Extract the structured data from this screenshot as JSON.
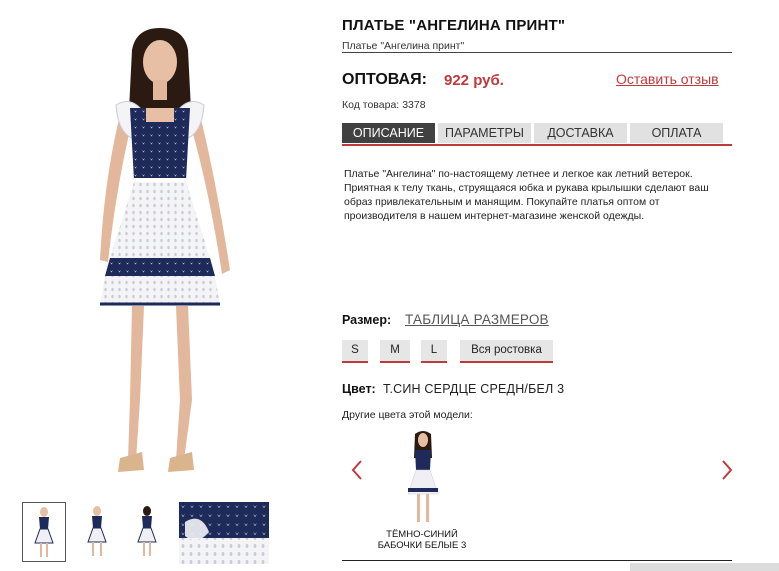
{
  "product": {
    "title": "ПЛАТЬЕ \"АНГЕЛИНА ПРИНТ\"",
    "subtitle": "Платье \"Ангелина принт\"",
    "price_label": "ОПТОВАЯ:",
    "price_value": "922 руб.",
    "review_link": "Оставить отзыв",
    "sku_label": "Код товара:",
    "sku_value": "3378"
  },
  "tabs": [
    {
      "label": "ОПИСАНИЕ",
      "active": true
    },
    {
      "label": "ПАРАМЕТРЫ",
      "active": false
    },
    {
      "label": "ДОСТАВКА",
      "active": false
    },
    {
      "label": "ОПЛАТА",
      "active": false
    }
  ],
  "description": "Платье \"Ангелина\" по-настоящему летнее и легкое как летний ветерок. Приятная к телу ткань, струящаяся юбка и рукава крылышки сделают ваш образ привлекательным и манящим. Покупайте платья оптом от производителя в нашем интернет-магазине женской одежды.",
  "size": {
    "label": "Размер:",
    "table_link": "ТАБЛИЦА РАЗМЕРОВ",
    "options": [
      "S",
      "M",
      "L",
      "Вся ростовка"
    ]
  },
  "color": {
    "label": "Цвет:",
    "value": "Т.СИН СЕРДЦЕ СРЕДН/БЕЛ 3",
    "other_label": "Другие цвета этой модели:",
    "variant_caption": "ТЁМНО-СИНИЙ БАБОЧКИ БЕЛЫЕ 3"
  },
  "icons": {
    "prev": "chevron-left-icon",
    "next": "chevron-right-icon"
  },
  "colors": {
    "accent": "#c0393b",
    "navy": "#1d2a5a",
    "tab_active": "#414141",
    "tab_inactive": "#e1e1e1"
  }
}
